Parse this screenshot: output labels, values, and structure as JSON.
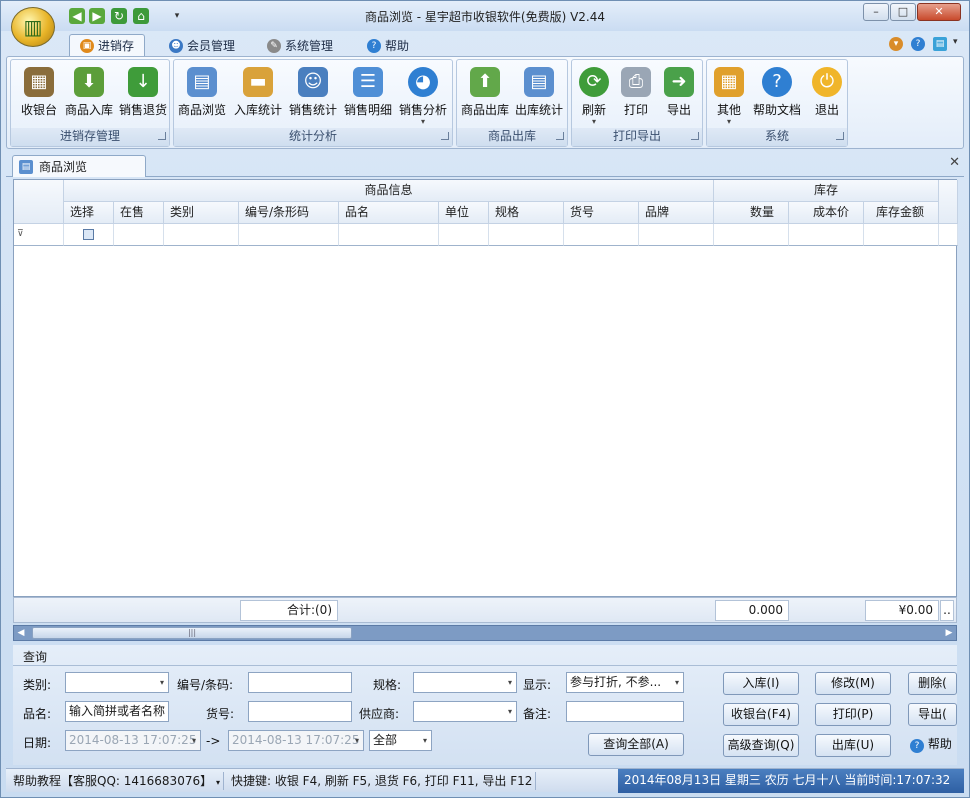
{
  "window": {
    "title": "商品浏览 - 星宇超市收银软件(免费版) V2.44"
  },
  "ribbon_tabs": [
    {
      "label": "进销存",
      "icon": "trolley-icon",
      "active": true
    },
    {
      "label": "会员管理",
      "icon": "members-icon"
    },
    {
      "label": "系统管理",
      "icon": "tools-icon"
    },
    {
      "label": "帮助",
      "icon": "help-icon"
    }
  ],
  "groups": {
    "g1": {
      "caption": "进销存管理",
      "buttons": [
        "收银台",
        "商品入库",
        "销售退货"
      ]
    },
    "g2": {
      "caption": "统计分析",
      "buttons": [
        "商品浏览",
        "入库统计",
        "销售统计",
        "销售明细",
        "销售分析"
      ]
    },
    "g3": {
      "caption": "商品出库",
      "buttons": [
        "商品出库",
        "出库统计"
      ]
    },
    "g4": {
      "caption": "打印导出",
      "buttons": [
        "刷新",
        "打印",
        "导出"
      ]
    },
    "g5": {
      "caption": "系统",
      "buttons": [
        "其他",
        "帮助文档",
        "退出"
      ]
    }
  },
  "doc_tab": {
    "label": "商品浏览"
  },
  "grid": {
    "band1": "商品信息",
    "band2": "库存",
    "columns": [
      "选择",
      "在售",
      "类别",
      "编号/条形码",
      "品名",
      "单位",
      "规格",
      "货号",
      "品牌",
      "数量",
      "成本价",
      "库存金额"
    ]
  },
  "summary": {
    "total": "合计:(0)",
    "qty": "0.000",
    "amount": "¥0.00",
    "more": ".."
  },
  "query": {
    "title": "查询",
    "labels": {
      "category": "类别:",
      "code": "编号/条码:",
      "spec": "规格:",
      "display": "显示:",
      "name": "品名:",
      "itemno": "货号:",
      "supplier": "供应商:",
      "remark": "备注:",
      "date": "日期:",
      "arrow": "->"
    },
    "display_value": "参与打折, 不参...",
    "name_value": "输入简拼或者名称",
    "date_from": "2014-08-13 17:07:25",
    "date_to": "2014-08-13 17:07:25",
    "scope": "全部",
    "buttons": {
      "query_all": "查询全部(A)",
      "in": "入库(I)",
      "modify": "修改(M)",
      "delete": "删除(",
      "pos": "收银台(F4)",
      "print": "打印(P)",
      "export": "导出(",
      "advanced": "高级查询(Q)",
      "out": "出库(U)",
      "help": "帮助"
    }
  },
  "status": {
    "help": "帮助教程【客服QQ: 1416683076】",
    "shortcuts": "快捷键: 收银 F4, 刷新 F5, 退货 F6, 打印 F11, 导出 F12",
    "datetime": "2014年08月13日 星期三 农历 七月十八 当前时间:17:07:32"
  }
}
